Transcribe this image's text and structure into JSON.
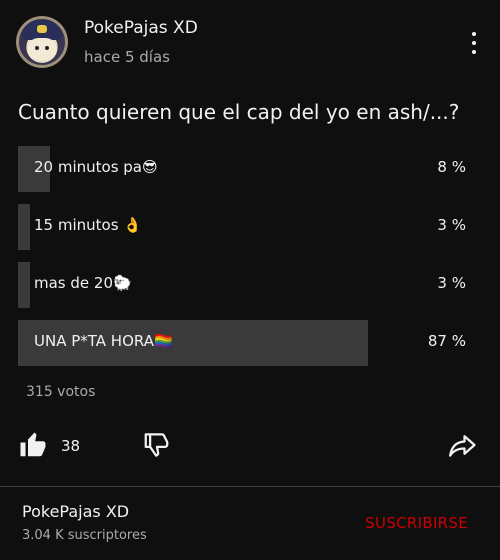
{
  "post": {
    "channel_name": "PokePajas XD",
    "time_ago": "hace 5 días",
    "question": "Cuanto quieren que el cap del yo en ash/...?"
  },
  "poll": {
    "options": [
      {
        "label": "20 minutos pa😎",
        "percent_text": "8 %",
        "percent": 8
      },
      {
        "label": "15 minutos 👌",
        "percent_text": "3 %",
        "percent": 3
      },
      {
        "label": "mas de 20🐑",
        "percent_text": "3 %",
        "percent": 3
      },
      {
        "label": "UNA P*TA HORA🏳️‍🌈",
        "percent_text": "87 %",
        "percent": 87
      }
    ],
    "votes": "315 votos"
  },
  "actions": {
    "like_icon": "thumbs-up-icon",
    "like_count": "38",
    "dislike_icon": "thumbs-down-icon",
    "share_icon": "share-icon"
  },
  "footer": {
    "channel_name": "PokePajas XD",
    "subscribers": "3.04 K suscriptores",
    "subscribe_label": "SUSCRIBIRSE"
  },
  "colors": {
    "background": "#0f0f0f",
    "bar": "#3a3a3a",
    "subscribe": "#cc0000"
  }
}
